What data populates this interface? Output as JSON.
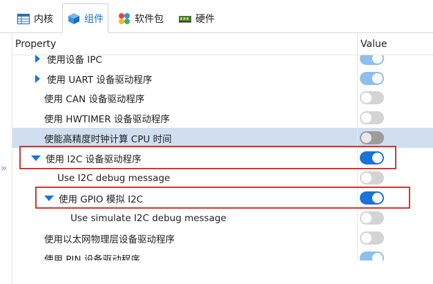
{
  "tabs": [
    {
      "label": "内核",
      "icon": "table-icon"
    },
    {
      "label": "组件",
      "icon": "cube-icon"
    },
    {
      "label": "软件包",
      "icon": "package-icon"
    },
    {
      "label": "硬件",
      "icon": "board-icon"
    }
  ],
  "header": {
    "property": "Property",
    "value": "Value"
  },
  "rows": [
    {
      "label": "使用设备 IPC",
      "state": "light-on",
      "arrow": "right"
    },
    {
      "label": "使用 UART 设备驱动程序",
      "state": "light-on",
      "arrow": "right"
    },
    {
      "label": "使用 CAN 设备驱动程序",
      "state": "off"
    },
    {
      "label": "使用 HWTIMER 设备驱动程序",
      "state": "off"
    },
    {
      "label": "使能高精度时钟计算 CPU 时间",
      "state": "dim-off",
      "selected": true
    },
    {
      "label": "使用 I2C 设备驱动程序",
      "state": "on",
      "arrow": "down"
    },
    {
      "label": "Use I2C debug message",
      "state": "off"
    },
    {
      "label": "使用 GPIO 模拟 I2C",
      "state": "on",
      "arrow": "down"
    },
    {
      "label": "Use simulate I2C debug message",
      "state": "off"
    },
    {
      "label": "使用以太网物理层设备驱动程序",
      "state": "off"
    },
    {
      "label": "使用 PIN 设备驱动程序",
      "state": "light-on"
    }
  ],
  "colors": {
    "accent": "#1a73d9",
    "highlight": "#d9322e",
    "selected_row": "#cfdff0"
  },
  "collapse_glyph": "»"
}
